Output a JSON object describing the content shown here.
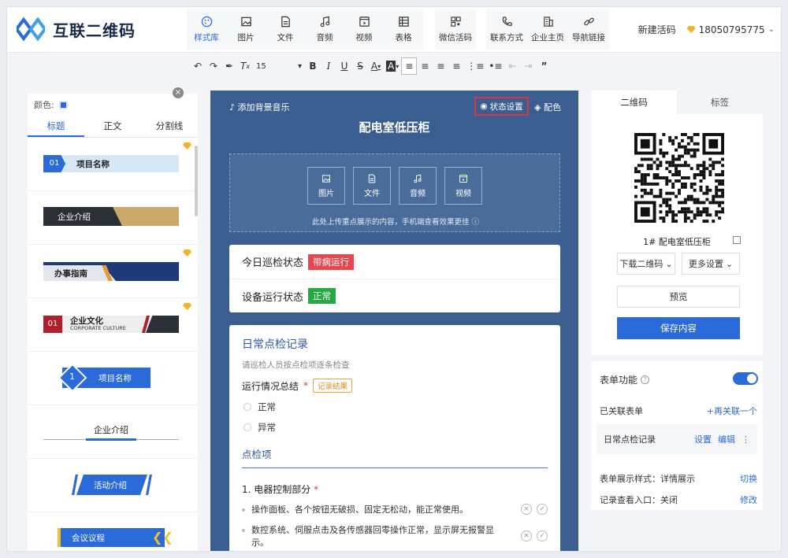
{
  "brand": {
    "name": "互联二维码"
  },
  "toolbar": {
    "group1": [
      {
        "label": "样式库",
        "icon": "palette-icon",
        "active": true
      },
      {
        "label": "图片",
        "icon": "image-icon"
      },
      {
        "label": "文件",
        "icon": "file-icon"
      },
      {
        "label": "音频",
        "icon": "music-icon"
      },
      {
        "label": "视频",
        "icon": "video-icon"
      },
      {
        "label": "表格",
        "icon": "table-icon"
      }
    ],
    "group2": [
      {
        "label": "微信活码",
        "icon": "wechat-qr-icon"
      }
    ],
    "group3": [
      {
        "label": "联系方式",
        "icon": "phone-icon"
      },
      {
        "label": "企业主页",
        "icon": "building-icon"
      },
      {
        "label": "导航链接",
        "icon": "link-icon"
      }
    ]
  },
  "header": {
    "new_code": "新建活码",
    "account": "18050795775"
  },
  "format": {
    "font_size": "15"
  },
  "left": {
    "color_label": "颜色:",
    "tabs": [
      "标题",
      "正文",
      "分割线"
    ],
    "templates": [
      {
        "num": "01",
        "text": "项目名称"
      },
      {
        "text": "企业介绍"
      },
      {
        "text": "办事指南"
      },
      {
        "num": "01",
        "text": "企业文化",
        "sub": "CORPORATE CULTURE"
      },
      {
        "num": "1",
        "text": "项目名称"
      },
      {
        "text": "企业介绍"
      },
      {
        "text": "活动介绍"
      },
      {
        "text": "会议议程"
      }
    ]
  },
  "center": {
    "music": "添加背景音乐",
    "state_settings": "状态设置",
    "color": "配色",
    "title": "配电室低压柜",
    "upload": {
      "buttons": [
        "图片",
        "文件",
        "音频",
        "视频"
      ],
      "hint": "此处上传重点展示的内容，手机端查看效果更佳"
    },
    "status": [
      {
        "label": "今日巡检状态",
        "value": "带病运行",
        "color": "#e8474f"
      },
      {
        "label": "设备运行状态",
        "value": "正常",
        "color": "#26a843"
      }
    ],
    "form": {
      "title": "日常点检记录",
      "subtitle": "请巡检人员按点检项逐条检查",
      "question": "运行情况总结",
      "pill": "记录结果",
      "options": [
        "正常",
        "异常"
      ],
      "section": "点检项",
      "ctrl": "1. 电器控制部分",
      "items": [
        "操作面板、各个按钮无破损、固定无松动，能正常使用。",
        "数控系统、伺服点击及各传感器回零操作正常，显示屏无报警显示。"
      ]
    }
  },
  "right": {
    "tabs": [
      "二维码",
      "标签"
    ],
    "name": "1# 配电室低压柜",
    "download": "下载二维码",
    "more": "更多设置",
    "preview": "预览",
    "save": "保存内容",
    "form_fn": "表单功能",
    "linked_label": "已关联表单",
    "relink": "+再关联一个",
    "linked_form": "日常点检记录",
    "settings": "设置",
    "edit": "编辑",
    "style_label": "表单展示样式：详情展示",
    "switch": "切换",
    "record_label": "记录查看入口：关闭",
    "modify": "修改"
  }
}
